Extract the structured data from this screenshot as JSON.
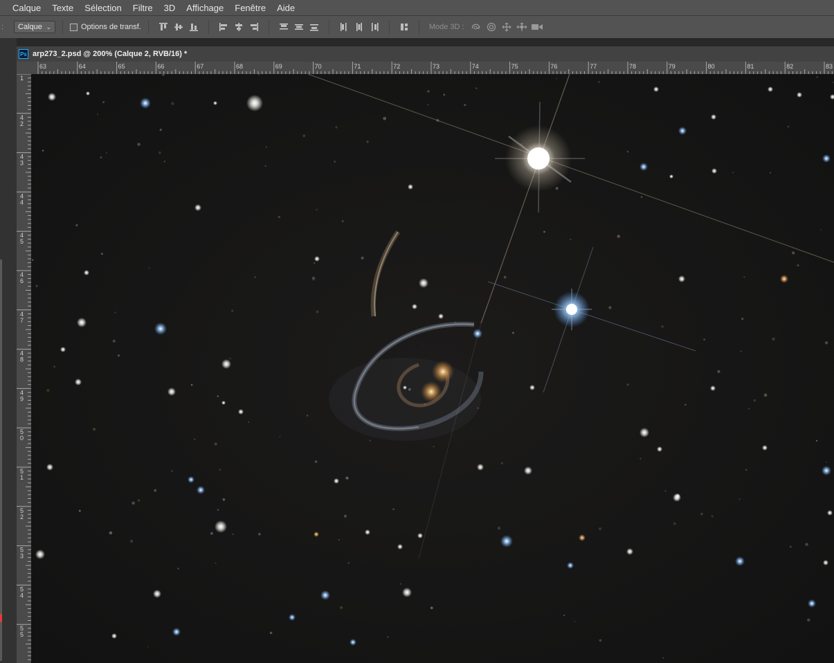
{
  "menubar": {
    "items": [
      "Calque",
      "Texte",
      "Sélection",
      "Filtre",
      "3D",
      "Affichage",
      "Fenêtre",
      "Aide"
    ]
  },
  "options": {
    "edge_glyph": ":",
    "auto_select_value": "Calque",
    "transform_controls_label": "Options de transf.",
    "transform_controls_checked": false,
    "mode3d_label": "Mode 3D :"
  },
  "document": {
    "ps_badge": "Ps",
    "tab_title": "arp273_2.psd @ 200% (Calque 2, RVB/16) *"
  },
  "rulers": {
    "horizontal_labels": [
      "63",
      "64",
      "65",
      "66",
      "67",
      "68",
      "69",
      "70",
      "71",
      "72",
      "73",
      "74",
      "75",
      "76",
      "77",
      "78",
      "79",
      "80",
      "81",
      "82",
      "83"
    ],
    "vertical_labels": [
      "1",
      "42",
      "43",
      "44",
      "45",
      "46",
      "47",
      "48",
      "49",
      "50",
      "51",
      "52",
      "53",
      "54",
      "55",
      "5"
    ]
  },
  "colors": {
    "menubar_bg": "#535353",
    "panel_bg": "#282828",
    "canvas_bg": "#131313",
    "ps_blue": "#31a8ff",
    "star_blue": "#8ec8ff",
    "star_warm": "#f3c98a"
  },
  "icons": {
    "option_buttons": [
      "align-top-edges-icon",
      "align-vertical-centers-icon",
      "align-bottom-edges-icon",
      "align-left-edges-icon",
      "align-horizontal-centers-icon",
      "align-right-edges-icon",
      "distribute-top-icon",
      "distribute-vertical-centers-icon",
      "distribute-bottom-icon",
      "distribute-left-icon",
      "distribute-horizontal-centers-icon",
      "distribute-right-icon",
      "auto-align-layers-icon"
    ],
    "mode3d_buttons": [
      "rotate-3d-icon",
      "roll-3d-icon",
      "drag-3d-icon",
      "slide-3d-icon",
      "scale-3d-icon"
    ]
  }
}
